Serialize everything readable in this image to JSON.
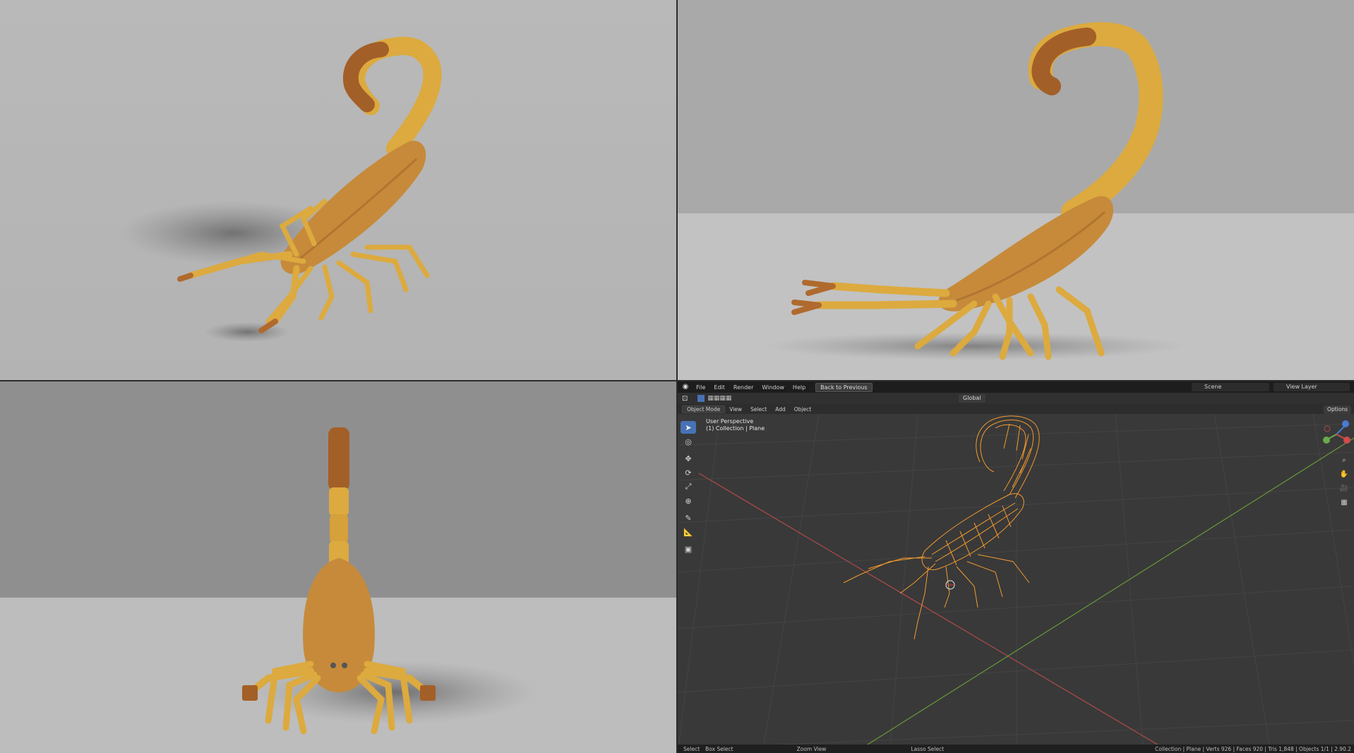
{
  "blender": {
    "menu": [
      "File",
      "Edit",
      "Render",
      "Window",
      "Help"
    ],
    "back_button": "Back to Previous",
    "scene": "Scene",
    "view_layer": "View Layer",
    "mode": "Object Mode",
    "header_menu": [
      "View",
      "Select",
      "Add",
      "Object"
    ],
    "transform_orientation": "Global",
    "options": "Options",
    "viewport_title": "User Perspective",
    "viewport_subtitle": "(1) Collection | Plane",
    "status": {
      "select": "Select",
      "box_select": "Box Select",
      "zoom_view": "Zoom View",
      "lasso_select": "Lasso Select",
      "stats": "Collection | Plane | Verts 926 | Faces 920 | Tris 1,848 | Objects 1/1 | 2.90.2"
    },
    "tools": [
      "select-box-icon",
      "cursor-icon",
      "move-icon",
      "rotate-icon",
      "scale-icon",
      "transform-icon",
      "annotate-icon",
      "measure-icon",
      "add-cube-icon"
    ]
  },
  "colors": {
    "scorpion_light": "#dcaa3e",
    "scorpion_mid": "#c68a3a",
    "scorpion_dark": "#9c5a2a",
    "wire": "#f39a2e",
    "accent": "#4772b3"
  }
}
